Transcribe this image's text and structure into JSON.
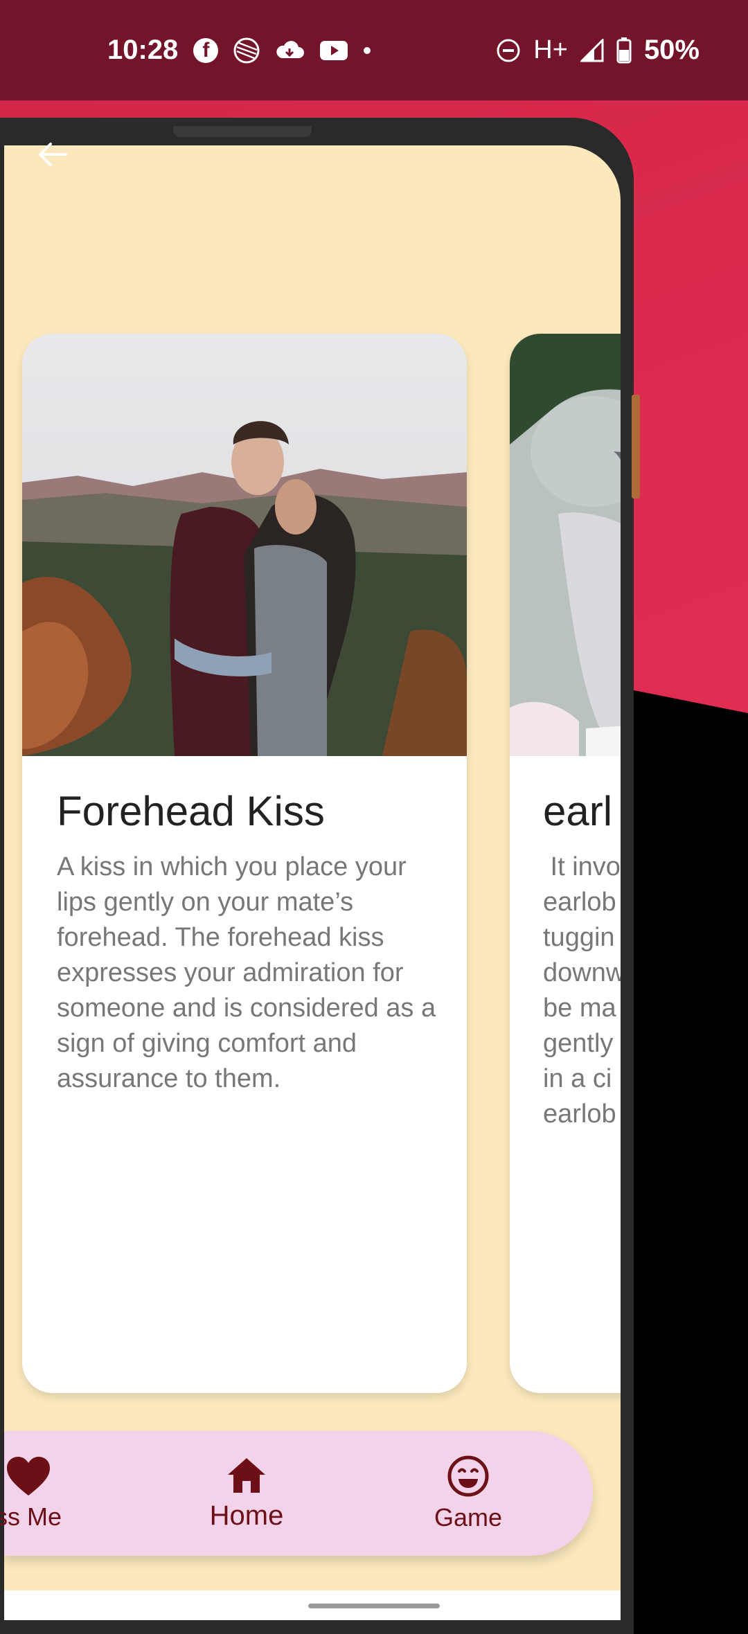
{
  "status_bar": {
    "time": "10:28",
    "network": "H+",
    "battery": "50%",
    "icons_left": [
      "facebook-icon",
      "sphere-app-icon",
      "cloud-icon",
      "youtube-icon",
      "notification-dot-icon"
    ],
    "icons_right": [
      "dnd-icon",
      "signal-icon",
      "battery-icon"
    ]
  },
  "colors": {
    "status_bg": "#73142a",
    "screen_bg": "#fbe8bd",
    "nav_bg": "#f3d3ea",
    "nav_fg": "#6d0f16",
    "accent_bg": "#e22f55"
  },
  "cards": [
    {
      "title": "Forehead Kiss",
      "description": "A kiss in which you place your lips gently on your mate’s forehead. The forehead kiss expresses your admiration for someone and is considered as a sign of giving comfort and assurance to them."
    },
    {
      "title": "earl",
      "description_lines": [
        " It invo",
        "earlob",
        "tuggin",
        "downw",
        "be ma",
        "gently",
        "in a ci",
        "earlob"
      ]
    }
  ],
  "nav": {
    "items": [
      {
        "label": "ss Me",
        "icon": "heart-icon"
      },
      {
        "label": "Home",
        "icon": "home-icon"
      },
      {
        "label": "Game",
        "icon": "smiley-icon"
      }
    ]
  }
}
